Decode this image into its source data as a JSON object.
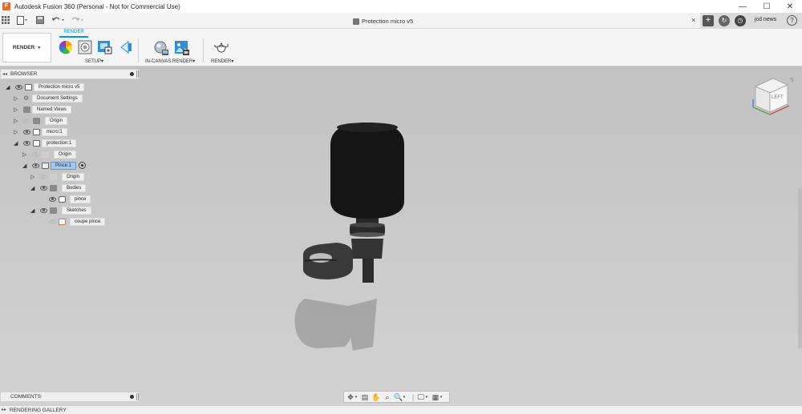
{
  "window": {
    "app_title": "Autodesk Fusion 360 (Personal - Not for Commercial Use)",
    "logo_letter": "F",
    "controls": {
      "minimize": "—",
      "maximize": "☐",
      "close": "✕"
    }
  },
  "tabbar": {
    "document_title": "Protection micro v5",
    "close_glyph": "×",
    "user_name": "jcd news",
    "help_glyph": "?"
  },
  "toolbar": {
    "workspace_label": "RENDER",
    "workspace_caret": "▼",
    "active_tab": "RENDER",
    "groups": {
      "setup": "SETUP",
      "in_canvas_render": "IN-CANVAS RENDER",
      "render": "RENDER"
    },
    "group_caret": "▾"
  },
  "browser": {
    "title": "BROWSER",
    "items": [
      {
        "label": "Protection micro v5"
      },
      {
        "label": "Document Settings"
      },
      {
        "label": "Named Views"
      },
      {
        "label": "Origin"
      },
      {
        "label": "micro:1"
      },
      {
        "label": "protection:1"
      },
      {
        "label": "Origin"
      },
      {
        "label": "Pince:1"
      },
      {
        "label": "Origin"
      },
      {
        "label": "Bodies"
      },
      {
        "label": "pince"
      },
      {
        "label": "Sketches"
      },
      {
        "label": "coupe pince"
      }
    ]
  },
  "panels": {
    "comments": "COMMENTS",
    "rendering_gallery": "RENDERING GALLERY"
  },
  "viewcube": {
    "face_label": "LEFT"
  },
  "colors": {
    "accent": "#0696d7",
    "viewport_background": "#c8c8c8",
    "selected_node": "#a9c7ea"
  }
}
